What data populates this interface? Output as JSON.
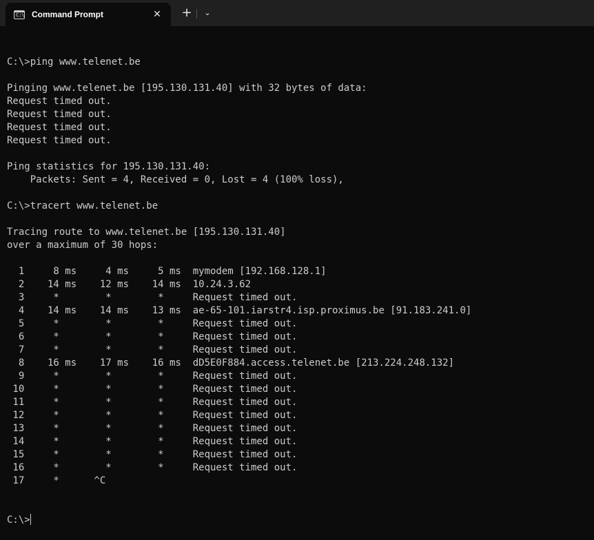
{
  "tab": {
    "title": "Command Prompt",
    "icon": "command-prompt-icon",
    "icon_glyph": "C:\\",
    "close_glyph": "✕",
    "new_tab_glyph": "+",
    "dropdown_glyph": "⌄"
  },
  "terminal": {
    "lines": [
      "C:\\>ping www.telenet.be",
      "",
      "Pinging www.telenet.be [195.130.131.40] with 32 bytes of data:",
      "Request timed out.",
      "Request timed out.",
      "Request timed out.",
      "Request timed out.",
      "",
      "Ping statistics for 195.130.131.40:",
      "    Packets: Sent = 4, Received = 0, Lost = 4 (100% loss),",
      "",
      "C:\\>tracert www.telenet.be",
      "",
      "Tracing route to www.telenet.be [195.130.131.40]",
      "over a maximum of 30 hops:",
      "",
      "  1     8 ms     4 ms     5 ms  mymodem [192.168.128.1]",
      "  2    14 ms    12 ms    14 ms  10.24.3.62",
      "  3     *        *        *     Request timed out.",
      "  4    14 ms    14 ms    13 ms  ae-65-101.iarstr4.isp.proximus.be [91.183.241.0]",
      "  5     *        *        *     Request timed out.",
      "  6     *        *        *     Request timed out.",
      "  7     *        *        *     Request timed out.",
      "  8    16 ms    17 ms    16 ms  dD5E0F884.access.telenet.be [213.224.248.132]",
      "  9     *        *        *     Request timed out.",
      " 10     *        *        *     Request timed out.",
      " 11     *        *        *     Request timed out.",
      " 12     *        *        *     Request timed out.",
      " 13     *        *        *     Request timed out.",
      " 14     *        *        *     Request timed out.",
      " 15     *        *        *     Request timed out.",
      " 16     *        *        *     Request timed out.",
      " 17     *      ^C"
    ],
    "prompt": "C:\\>"
  }
}
